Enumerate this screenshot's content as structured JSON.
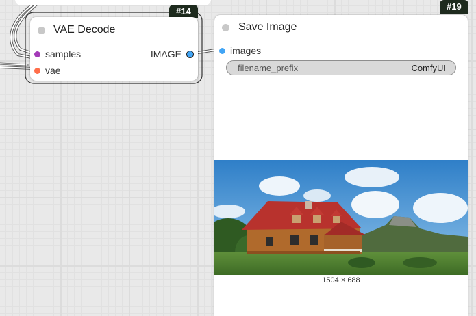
{
  "nodes": {
    "vae_decode": {
      "title": "VAE Decode",
      "badge": "#14",
      "inputs": [
        {
          "label": "samples",
          "color": "#a43bb8"
        },
        {
          "label": "vae",
          "color": "#ff6e4a"
        }
      ],
      "output": {
        "label": "IMAGE",
        "color": "#42a5f5"
      }
    },
    "save_image": {
      "title": "Save Image",
      "badge": "#19",
      "input": {
        "label": "images",
        "color": "#42a5f5"
      },
      "widget": {
        "label": "filename_prefix",
        "value": "ComfyUI"
      },
      "preview": {
        "description": "house-photo",
        "caption": "1504 × 688"
      }
    }
  },
  "colors": {
    "title_dot": "#c8c8c8",
    "badge_bg": "#1e2b1e",
    "wire": "#ffffff"
  }
}
